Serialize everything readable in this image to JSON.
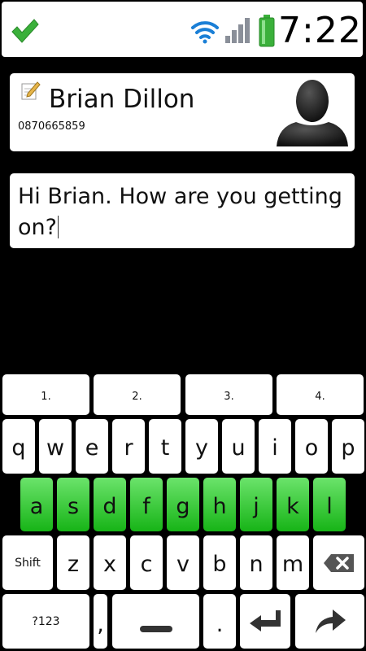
{
  "status_bar": {
    "time": "7:22",
    "icons": [
      "check-icon",
      "wifi-icon",
      "signal-icon",
      "battery-icon"
    ],
    "colors": {
      "check": "#3ab03a",
      "wifi": "#1a7fd6",
      "battery": "#3ab03a"
    }
  },
  "contact": {
    "name": "Brian Dillon",
    "number": "0870665859"
  },
  "message": {
    "text": "Hi Brian. How are you getting on?"
  },
  "keyboard": {
    "number_row": [
      "1.",
      "2.",
      "3.",
      "4."
    ],
    "row1": [
      "q",
      "w",
      "e",
      "r",
      "t",
      "y",
      "u",
      "i",
      "o",
      "p"
    ],
    "row2": [
      "a",
      "s",
      "d",
      "f",
      "g",
      "h",
      "j",
      "k",
      "l"
    ],
    "row3": [
      "z",
      "x",
      "c",
      "v",
      "b",
      "n",
      "m"
    ],
    "shift_label": "Shift",
    "symbols_label": "?123",
    "comma_label": ",",
    "period_label": ".",
    "highlight_color": "#2ac02a"
  }
}
